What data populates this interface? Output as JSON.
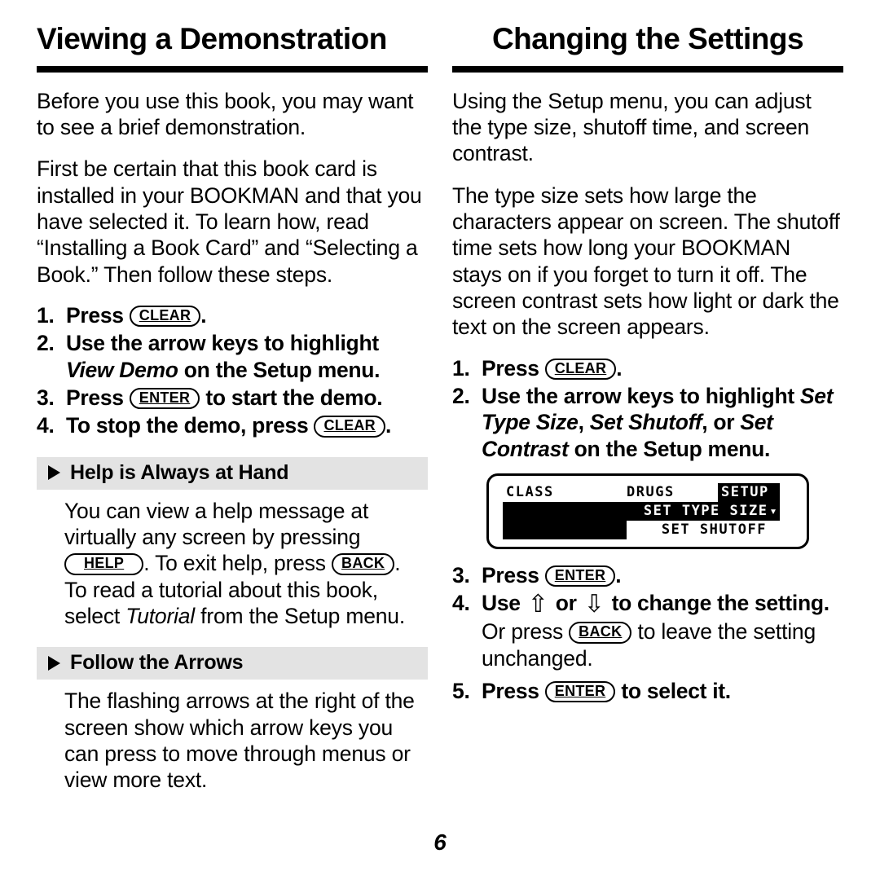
{
  "page": {
    "number": "6"
  },
  "left_column": {
    "title": "Viewing a Demonstration",
    "paragraphs": [
      "Before you use this book, you may want to see a brief demonstration.",
      "First be certain that this book card is installed in your BOOKMAN and that you have selected it. To learn how, read “Installing a Book Card” and “Selecting a Book.” Then follow these steps."
    ],
    "steps": [
      {
        "num": "1.",
        "pre": "Press ",
        "key": "CLEAR",
        "post": "."
      },
      {
        "num": "2.",
        "pre": "Use the arrow keys to highlight ",
        "italic": "View Demo",
        "post": " on the Setup menu."
      },
      {
        "num": "3.",
        "pre": "Press ",
        "key": "ENTER",
        "post": " to start the demo."
      },
      {
        "num": "4.",
        "pre": "To stop the demo, press ",
        "key": "CLEAR",
        "post": "."
      }
    ],
    "sections": [
      {
        "heading": "Help is Always at Hand",
        "body_1": "You can view a help message at virtually any screen by pressing ",
        "key_1": "HELP",
        "body_2": ". To exit help, press ",
        "key_2": "BACK",
        "body_3": ". To read a tutorial about this book, select ",
        "italic_1": "Tutorial",
        "body_4": " from the Setup menu."
      },
      {
        "heading": "Follow the Arrows",
        "body_1": "The flashing arrows at the right of the screen show which arrow keys you can press to move through menus or view more text."
      }
    ]
  },
  "right_column": {
    "title": "Changing the Settings",
    "paragraphs": [
      "Using the Setup menu, you can adjust the type size, shutoff time, and screen contrast.",
      "The type size sets how large the characters appear on screen. The shutoff time sets how long your BOOKMAN stays on if you forget to turn it off. The screen contrast sets how light or dark the text on the screen appears."
    ],
    "steps_before_lcd": [
      {
        "num": "1.",
        "pre": "Press ",
        "key": "CLEAR",
        "post": "."
      },
      {
        "num": "2.",
        "pre": "Use the arrow keys to highlight ",
        "italic_1": "Set Type Size",
        "mid_1": ", ",
        "italic_2": "Set Shutoff",
        "mid_2": ", or ",
        "italic_3": "Set Contrast",
        "post": " on the Setup menu."
      }
    ],
    "lcd_screen": {
      "tab_class": "CLASS",
      "tab_drugs": "DRUGS",
      "tab_setup": "SETUP",
      "menu_item_1": "SET TYPE SIZE",
      "menu_item_1_arrow": "▾",
      "menu_item_2": "SET SHUTOFF"
    },
    "steps_after_lcd": [
      {
        "num": "3.",
        "pre": "Press ",
        "key": "ENTER",
        "post": "."
      },
      {
        "num": "4.",
        "pre": "Use ",
        "arrow_up": "⇧",
        "mid": " or ",
        "arrow_down": "⇩",
        "post": " to change the setting."
      }
    ],
    "substep": {
      "pre": "Or press ",
      "key": "BACK",
      "post": " to leave the setting unchanged."
    },
    "step_last": {
      "num": "5.",
      "pre": "Press ",
      "key": "ENTER",
      "post": " to select it."
    }
  },
  "colors": {
    "section_band": "#e3e3e3",
    "ink": "#000000",
    "paper": "#ffffff"
  }
}
